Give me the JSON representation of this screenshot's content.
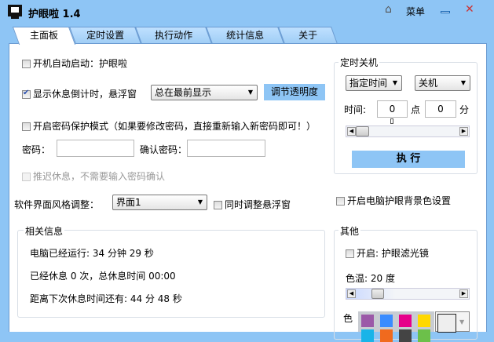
{
  "window": {
    "title": "护眼啦 1.4",
    "menu": "菜单",
    "icons": [
      "monitor-icon",
      "home-icon",
      "minimize-icon",
      "close-icon"
    ]
  },
  "tabs": [
    "主面板",
    "定时设置",
    "执行动作",
    "统计信息",
    "关于"
  ],
  "main": {
    "autostart": "开机自动启动：护眼啦",
    "show_countdown": "显示休息倒计时，悬浮窗",
    "float_mode": "总在最前显示",
    "adjust_opacity": "调节透明度",
    "password_mode": "开启密码保护模式（如果要修改密码，直接重新输入新密码即可！）",
    "password_label": "密码：",
    "confirm_label": "确认密码：",
    "postpone": "推迟休息，不需要输入密码确认",
    "style_label": "软件界面风格调整：",
    "style_value": "界面1",
    "sync_float": "同时调整悬浮窗"
  },
  "info": {
    "title": "相关信息",
    "uptime": "电脑已经运行: 34 分钟 29 秒",
    "rest": "已经休息 0 次，总休息时间 00:00",
    "next": "距离下次休息时间还有: 44 分 48 秒"
  },
  "shutdown": {
    "title": "定时关机",
    "mode": "指定时间",
    "action": "关机",
    "time_label": "时间:",
    "hour": "0",
    "hour_unit": "点",
    "minute": "0",
    "minute_unit": "分",
    "execute": "执 行"
  },
  "bg_setting": "开启电脑护眼背景色设置",
  "other": {
    "title": "其他",
    "filter": "开启: 护眼滤光镜",
    "temp_label": "色温: 20 度",
    "temp_value": 20,
    "color_label": "色",
    "swatches": [
      "#9b59a8",
      "#3a8cff",
      "#e6008a",
      "#ffd800",
      "#19b4e8",
      "#f06a1e",
      "#444444",
      "#6cc04a"
    ]
  }
}
